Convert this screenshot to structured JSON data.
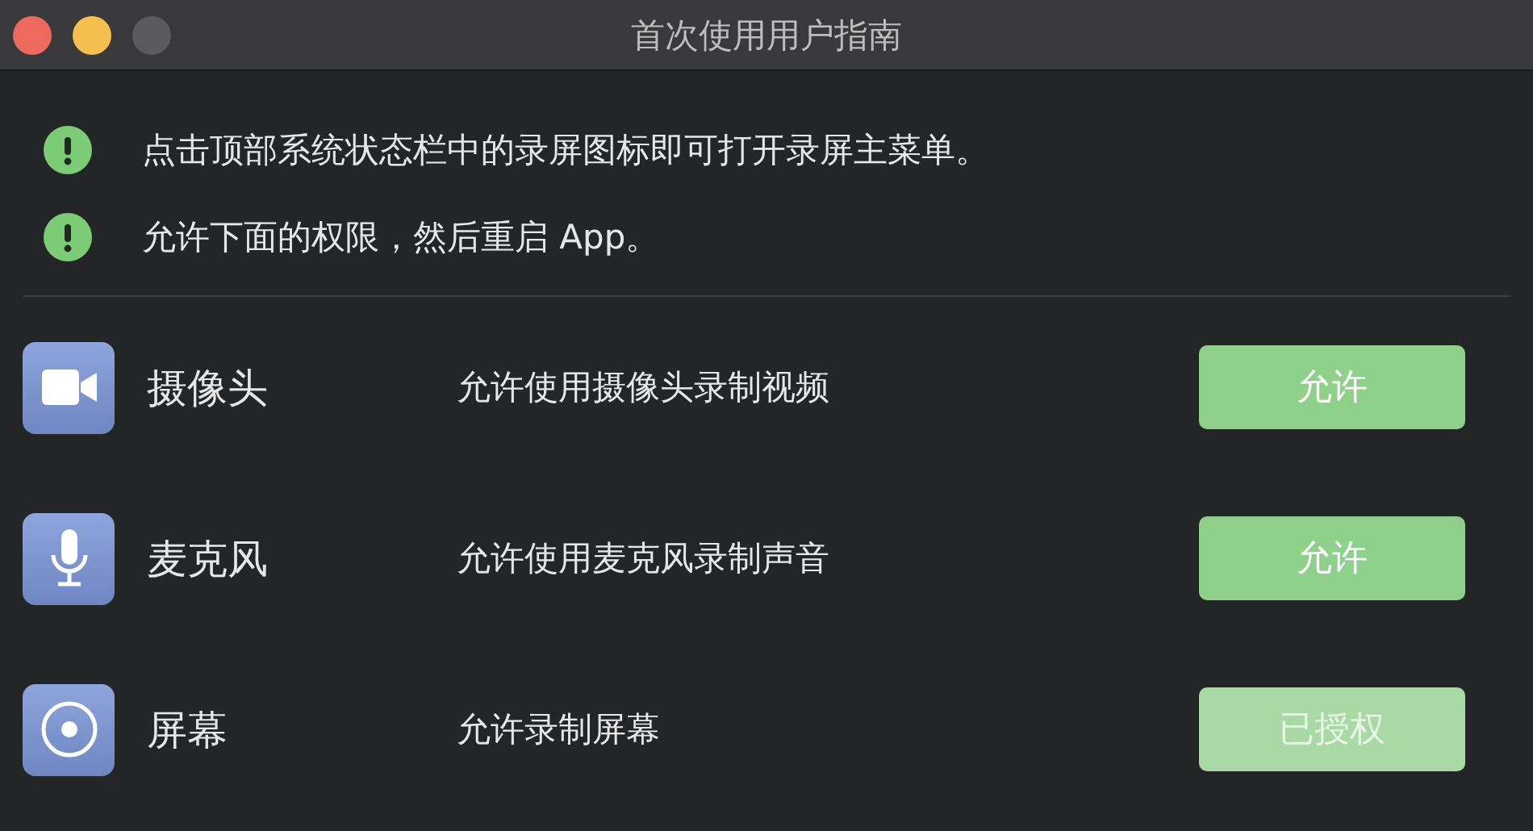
{
  "window": {
    "title": "首次使用用户指南"
  },
  "notices": [
    "点击顶部系统状态栏中的录屏图标即可打开录屏主菜单。",
    "允许下面的权限，然后重启 App。"
  ],
  "permissions": [
    {
      "kind": "camera",
      "name": "摄像头",
      "description": "允许使用摄像头录制视频",
      "button": "允许",
      "disabled": false
    },
    {
      "kind": "microphone",
      "name": "麦克风",
      "description": "允许使用麦克风录制声音",
      "button": "允许",
      "disabled": false
    },
    {
      "kind": "screen",
      "name": "屏幕",
      "description": "允许录制屏幕",
      "button": "已授权",
      "disabled": true
    }
  ]
}
